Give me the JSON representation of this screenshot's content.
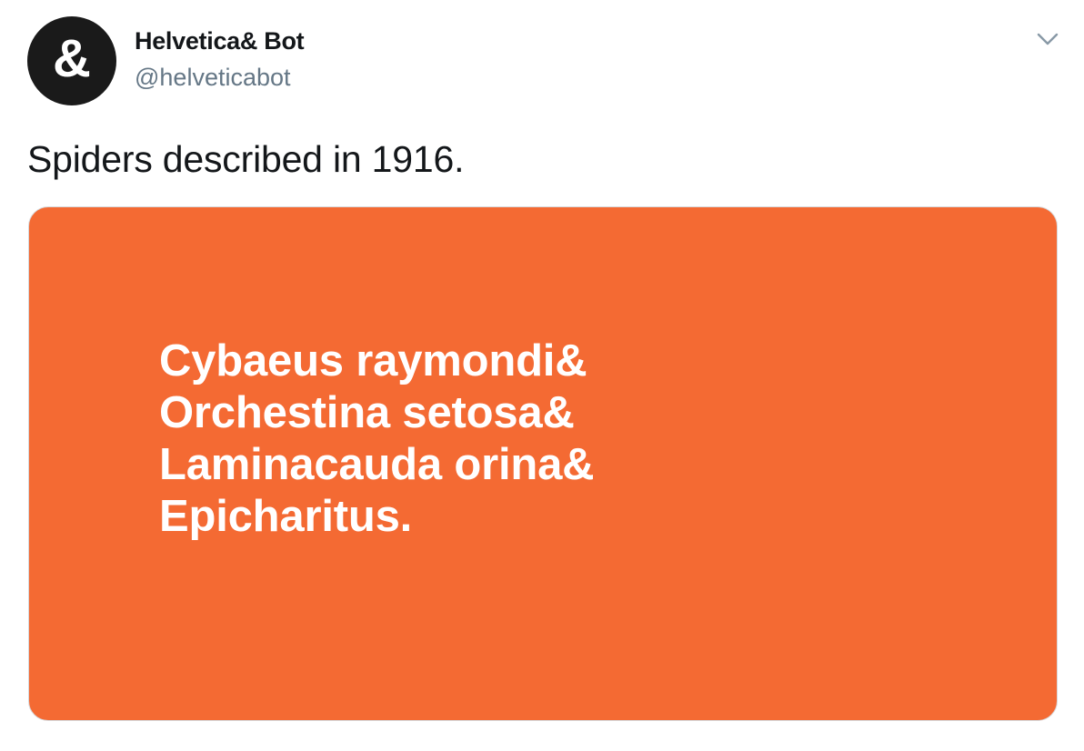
{
  "tweet": {
    "author": {
      "display_name": "Helvetica& Bot",
      "handle": "@helveticabot",
      "avatar_glyph": "&",
      "avatar_color": "#1a1a1a"
    },
    "menu_icon": "chevron-down-icon",
    "text": "Spiders described in 1916.",
    "media": {
      "background_color": "#f46a33",
      "text_color": "#ffffff",
      "lines": [
        "Cybaeus raymondi&",
        "Orchestina setosa&",
        "Laminacauda orina&",
        "Epicharitus."
      ]
    }
  }
}
